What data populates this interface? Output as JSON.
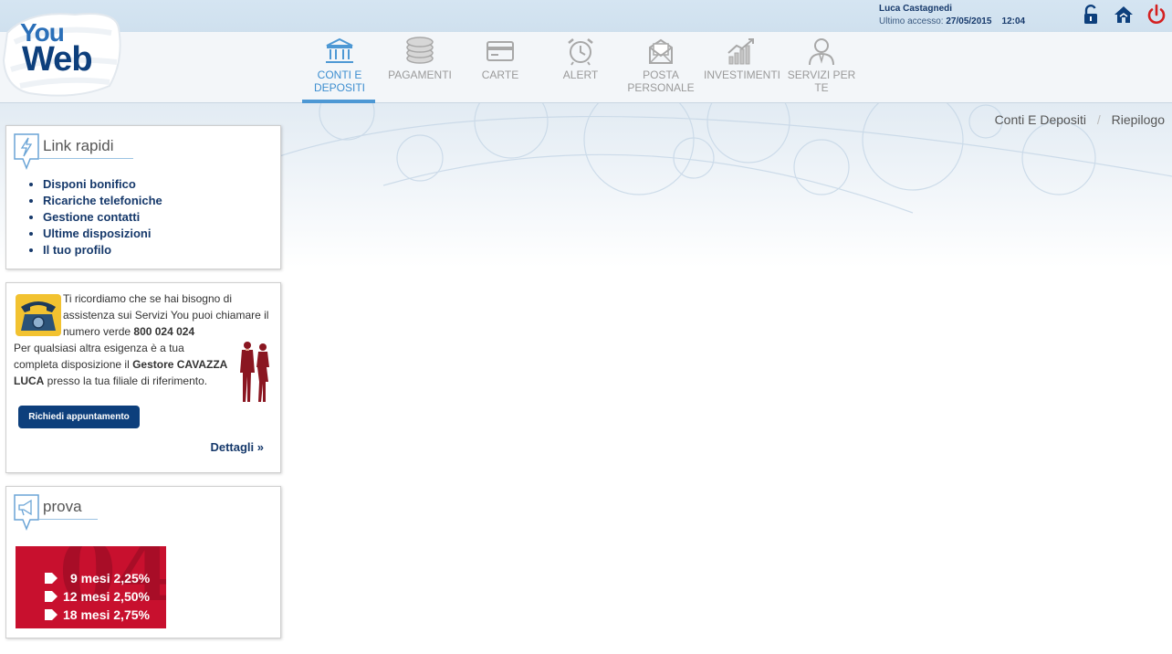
{
  "logo": {
    "line1": "You",
    "line2": "Web"
  },
  "user": {
    "name": "Luca Castagnedi",
    "last_access_label": "Ultimo accesso:",
    "last_access_date": "27/05/2015",
    "last_access_time": "12:04"
  },
  "top_icons": [
    "lock-icon",
    "home-icon",
    "power-icon"
  ],
  "nav": {
    "items": [
      {
        "label": "CONTI E DEPOSITI",
        "icon": "bank-icon",
        "active": true
      },
      {
        "label": "PAGAMENTI",
        "icon": "coins-icon"
      },
      {
        "label": "CARTE",
        "icon": "card-icon"
      },
      {
        "label": "ALERT",
        "icon": "alarm-clock-icon"
      },
      {
        "label": "POSTA PERSONALE",
        "icon": "envelope-icon"
      },
      {
        "label": "INVESTIMENTI",
        "icon": "chart-icon"
      },
      {
        "label": "SERVIZI PER TE",
        "icon": "person-icon"
      }
    ],
    "active_color": "#3d8ed0"
  },
  "breadcrumb": {
    "items": [
      "Conti E Depositi",
      "Riepilogo"
    ]
  },
  "quick_links": {
    "title": "Link rapidi",
    "icon": "lightning-icon",
    "items": [
      "Disponi bonifico",
      "Ricariche telefoniche",
      "Gestione contatti",
      "Ultime disposizioni",
      "Il tuo profilo"
    ]
  },
  "contact": {
    "phone_icon": "telephone-icon",
    "people_icon": "business-people-icon",
    "text1": "Ti ricordiamo che se hai bisogno di assistenza sui Servizi You puoi chiamare il numero verde",
    "phone_number": "800 024 024",
    "text2": "Per qualsiasi altra esigenza è a tua completa disposizione il",
    "manager": "Gestore CAVAZZA LUCA",
    "text3": "presso la tua filiale di riferimento.",
    "button_label": "Richiedi appuntamento",
    "details_label": "Dettagli »"
  },
  "promo_panel": {
    "title": "prova",
    "icon": "megaphone-icon",
    "rows": [
      "9 mesi 2,25%",
      "12 mesi 2,50%",
      "18 mesi 2,75%"
    ],
    "background_text": "04",
    "color": "#c8102e"
  }
}
